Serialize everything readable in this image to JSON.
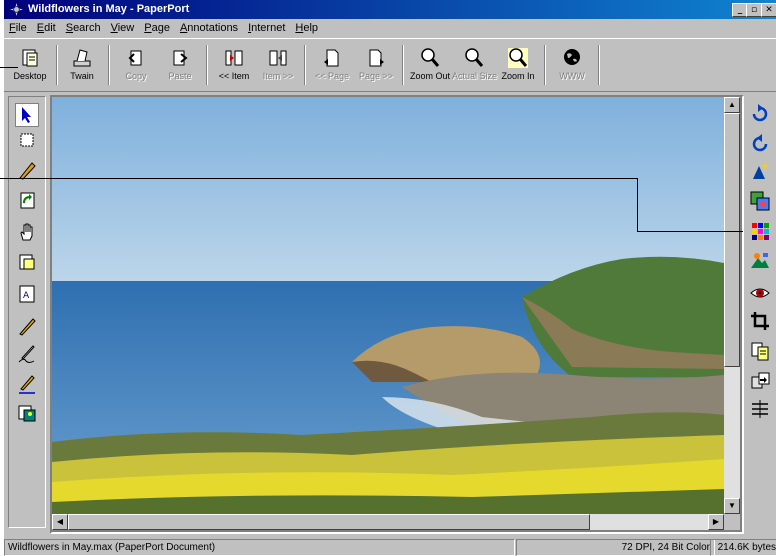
{
  "window": {
    "title": "Wildflowers in May - PaperPort"
  },
  "caption_buttons": {
    "minimize": "_",
    "maximize": "▫",
    "close": "✕"
  },
  "menu": [
    "File",
    "Edit",
    "Search",
    "View",
    "Page",
    "Annotations",
    "Internet",
    "Help"
  ],
  "toolbar": [
    {
      "label": "Desktop",
      "icon": "desktop-icon",
      "enabled": true
    },
    {
      "label": "Twain",
      "icon": "scanner-icon",
      "enabled": true
    },
    {
      "label": "Copy",
      "icon": "copy-icon",
      "enabled": false
    },
    {
      "label": "Paste",
      "icon": "paste-icon",
      "enabled": false
    },
    {
      "label": "<< Item",
      "icon": "prev-item-icon",
      "enabled": true
    },
    {
      "label": "Item >>",
      "icon": "next-item-icon",
      "enabled": false
    },
    {
      "label": "<< Page",
      "icon": "prev-page-icon",
      "enabled": false
    },
    {
      "label": "Page >>",
      "icon": "next-page-icon",
      "enabled": false
    },
    {
      "label": "Zoom Out",
      "icon": "zoom-out-icon",
      "enabled": true
    },
    {
      "label": "Actual Size",
      "icon": "actual-size-icon",
      "enabled": false
    },
    {
      "label": "Zoom In",
      "icon": "zoom-in-icon",
      "enabled": true
    },
    {
      "label": "WWW",
      "icon": "globe-icon",
      "enabled": false
    }
  ],
  "left_tools": [
    "arrow-select-icon",
    "marquee-select-icon",
    "highlighter-icon",
    "rotate-page-icon",
    "hand-pan-icon",
    "note-icon",
    "stamp-icon",
    "pen-icon",
    "signature-icon",
    "line-pen-icon",
    "insert-image-icon"
  ],
  "right_tools": [
    "rotate-clockwise-icon",
    "rotate-counterclockwise-icon",
    "enhance-icon",
    "image-adjust-icon",
    "color-grid-icon",
    "sharpen-icon",
    "red-eye-icon",
    "crop-icon",
    "copy-page-icon",
    "convert-icon",
    "straighten-icon"
  ],
  "status": {
    "filename": "Wildflowers in May.max (PaperPort Document)",
    "resolution": "72 DPI, 24 Bit Color",
    "size": "214.6K bytes"
  }
}
